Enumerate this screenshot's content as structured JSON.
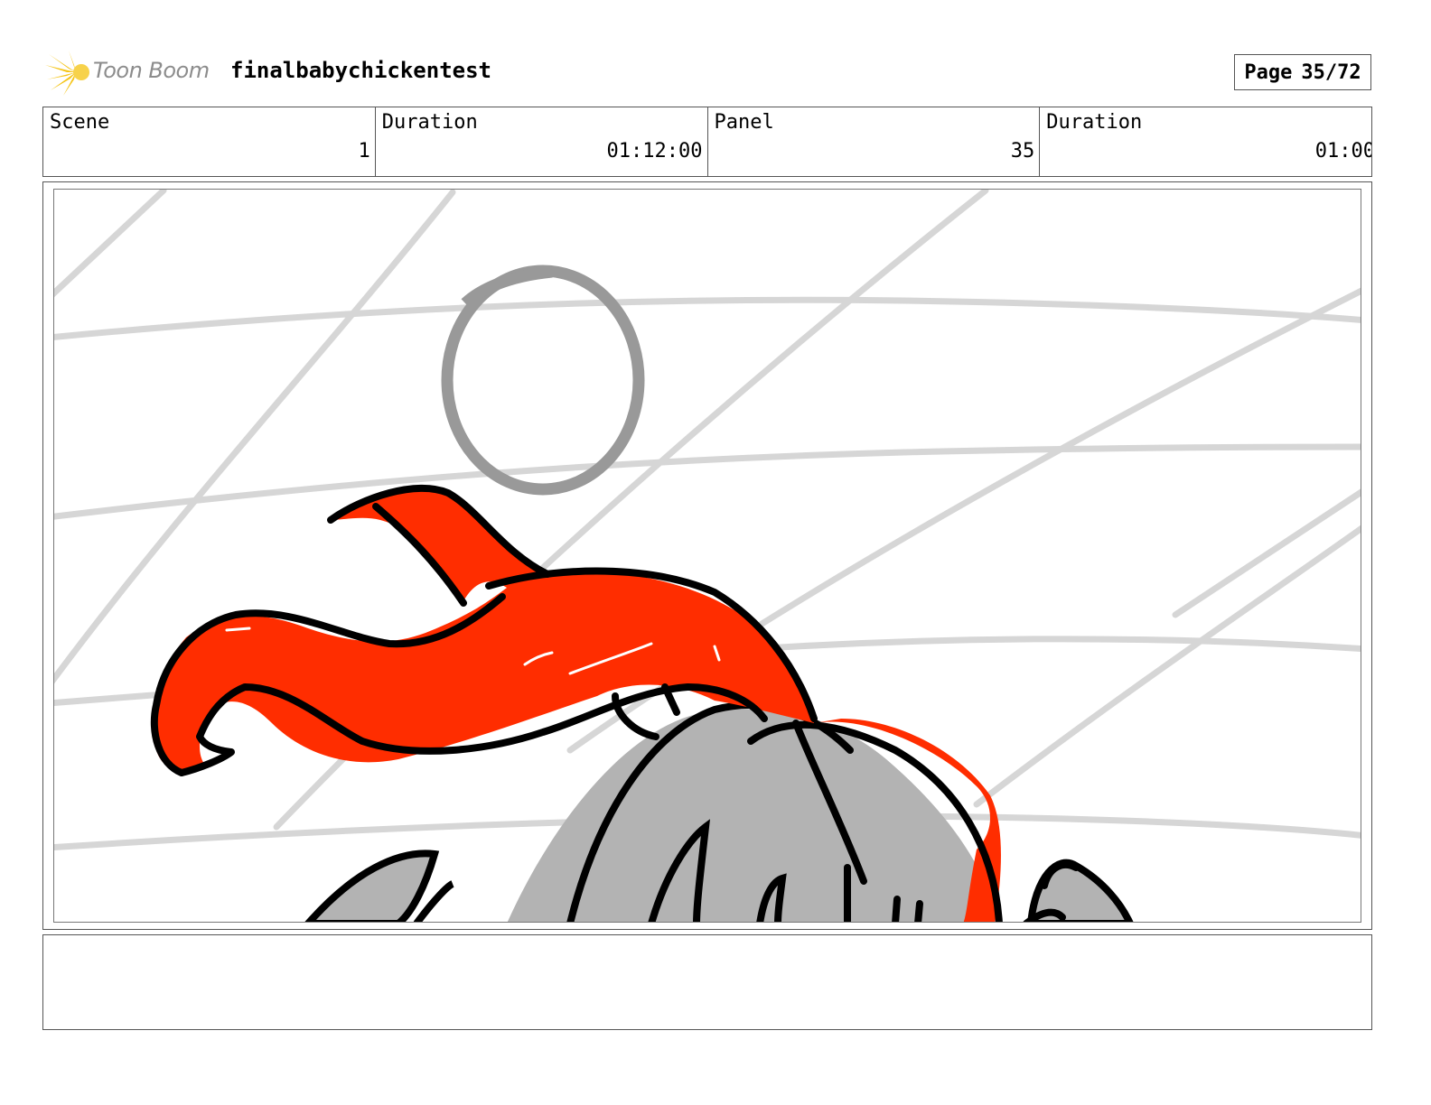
{
  "header": {
    "brand": "Toon Boom",
    "project_title": "finalbabychickentest",
    "page_label": "Page",
    "page_value": "35/72"
  },
  "info": {
    "scene_label": "Scene",
    "scene_value": "1",
    "scene_duration_label": "Duration",
    "scene_duration_value": "01:12:00",
    "panel_label": "Panel",
    "panel_value": "35",
    "panel_duration_label": "Duration",
    "panel_duration_value": "01:00"
  },
  "colors": {
    "ribbon": "#ff2d00",
    "head": "#b3b3b3",
    "grid": "#d6d6d6",
    "circle": "#999999",
    "logo_star": "#f5c518"
  },
  "notes": {
    "text": ""
  }
}
